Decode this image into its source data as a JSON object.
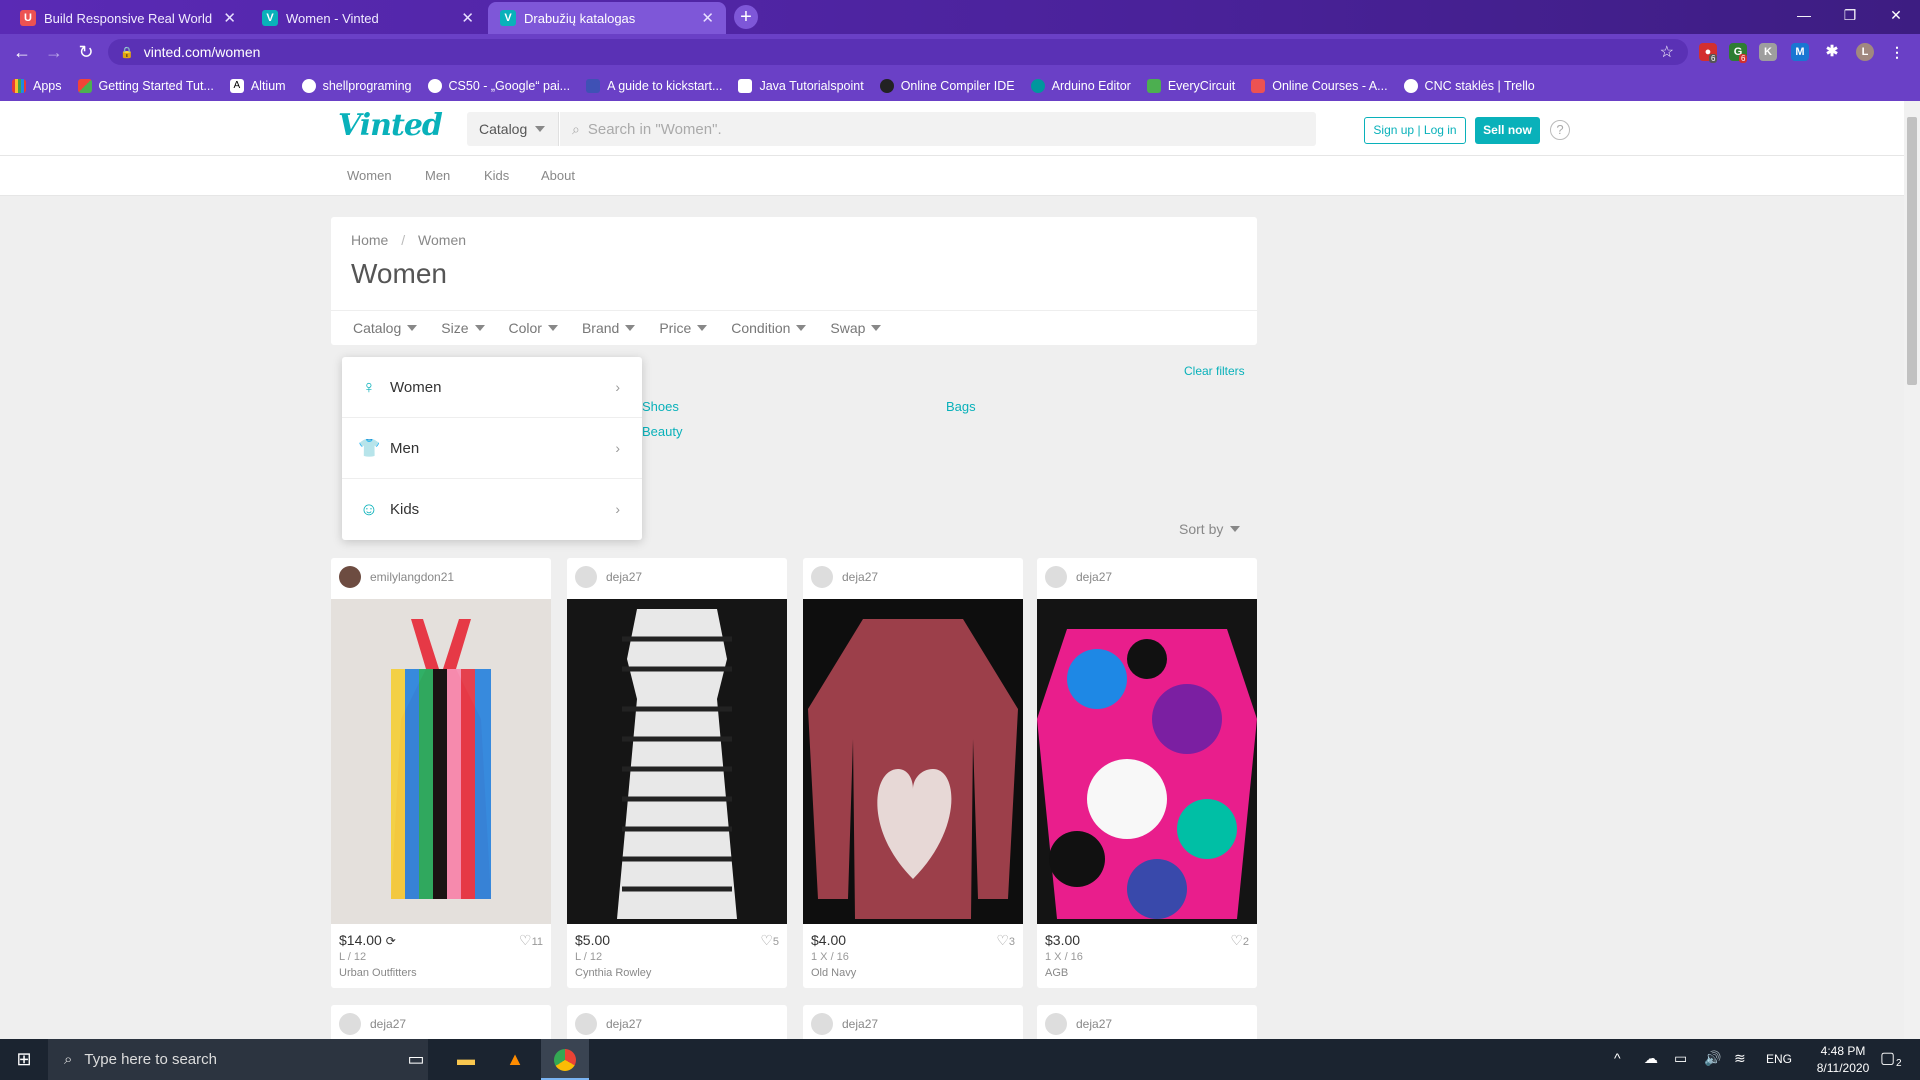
{
  "browser": {
    "tabs": [
      {
        "title": "Build Responsive Real World Wel",
        "favicon": "U"
      },
      {
        "title": "Women - Vinted",
        "favicon": "V"
      },
      {
        "title": "Drabužių katalogas",
        "favicon": "V"
      }
    ],
    "url": "vinted.com/women",
    "bookmarks": [
      "Apps",
      "Getting Started Tut...",
      "Altium",
      "shellprograming",
      "CS50 - „Google“ pai...",
      "A guide to kickstart...",
      "Java  Tutorialspoint",
      "Online Compiler IDE",
      "Arduino Editor",
      "EveryCircuit",
      "Online Courses - A...",
      "CNC staklės | Trello"
    ],
    "profile_initial": "L",
    "ext_badges": [
      "6",
      "6"
    ]
  },
  "header": {
    "logo": "Vinted",
    "catalog_label": "Catalog",
    "search_placeholder": "Search in \"Women\".",
    "signup": "Sign up | Log in",
    "sell": "Sell now",
    "help": "?"
  },
  "subnav": [
    "Women",
    "Men",
    "Kids",
    "About"
  ],
  "catalog": {
    "breadcrumb_home": "Home",
    "breadcrumb_sep": "/",
    "breadcrumb_current": "Women",
    "title": "Women",
    "filters": [
      "Catalog",
      "Size",
      "Color",
      "Brand",
      "Price",
      "Condition",
      "Swap"
    ],
    "clear_filters": "Clear filters",
    "categories": [
      "Shoes",
      "Bags",
      "Beauty"
    ],
    "sort_by": "Sort by"
  },
  "dropdown": {
    "items": [
      {
        "label": "Women",
        "icon": "woman-icon"
      },
      {
        "label": "Men",
        "icon": "shirt-icon"
      },
      {
        "label": "Kids",
        "icon": "baby-face-icon"
      }
    ]
  },
  "products": [
    {
      "user": "emilylangdon21",
      "price": "$14.00",
      "size": "L / 12",
      "brand": "Urban Outfitters",
      "favorites": "11",
      "swap": true
    },
    {
      "user": "deja27",
      "price": "$5.00",
      "size": "L / 12",
      "brand": "Cynthia Rowley",
      "favorites": "5",
      "swap": false
    },
    {
      "user": "deja27",
      "price": "$4.00",
      "size": "1 X / 16",
      "brand": "Old Navy",
      "favorites": "3",
      "swap": false
    },
    {
      "user": "deja27",
      "price": "$3.00",
      "size": "1 X / 16",
      "brand": "AGB",
      "favorites": "2",
      "swap": false
    }
  ],
  "products_row2_users": [
    "deja27",
    "deja27",
    "deja27",
    "deja27"
  ],
  "taskbar": {
    "search_placeholder": "Type here to search",
    "lang": "ENG",
    "time": "4:48 PM",
    "date": "8/11/2020",
    "notifications": "2"
  },
  "colors": {
    "accent": "#09b1ba",
    "browser": "#6a40c6"
  }
}
